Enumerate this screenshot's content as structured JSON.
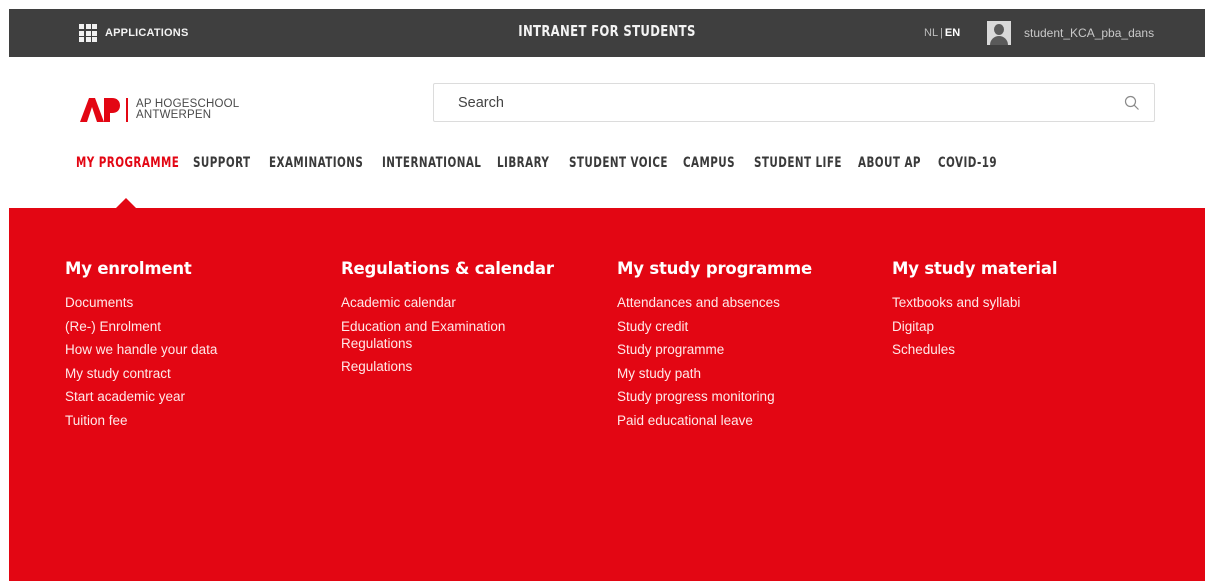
{
  "topbar": {
    "applications_label": "APPLICATIONS",
    "apps_icon": "grid-icon",
    "title": "INTRANET FOR STUDENTS",
    "lang_nl": "NL",
    "lang_sep": "|",
    "lang_en": "EN",
    "avatar_icon": "user-avatar-icon",
    "username": "student_KCA_pba_dans"
  },
  "logo": {
    "mark": "AP",
    "line1": "AP HOGESCHOOL",
    "line2": "ANTWERPEN",
    "brand_color": "#e30613"
  },
  "search": {
    "placeholder": "Search",
    "icon": "search-icon"
  },
  "nav": {
    "items": [
      {
        "label": "MY PROGRAMME",
        "active": true
      },
      {
        "label": "SUPPORT"
      },
      {
        "label": "EXAMINATIONS"
      },
      {
        "label": "INTERNATIONAL"
      },
      {
        "label": "LIBRARY"
      },
      {
        "label": "STUDENT VOICE"
      },
      {
        "label": "CAMPUS"
      },
      {
        "label": "STUDENT LIFE"
      },
      {
        "label": "ABOUT AP"
      },
      {
        "label": "COVID-19"
      }
    ]
  },
  "mega": {
    "columns": [
      {
        "title": "My enrolment",
        "links": [
          "Documents",
          "(Re-) Enrolment",
          "How we handle your data",
          "My study contract",
          "Start academic year",
          "Tuition fee"
        ]
      },
      {
        "title": "Regulations & calendar",
        "links": [
          "Academic calendar",
          "Education and Examination Regulations",
          "Regulations"
        ]
      },
      {
        "title": "My study programme",
        "links": [
          "Attendances and absences",
          "Study credit",
          "Study programme",
          "My study path",
          "Study progress monitoring",
          "Paid educational leave"
        ]
      },
      {
        "title": "My study material",
        "links": [
          "Textbooks and syllabi",
          "Digitap",
          "Schedules"
        ]
      }
    ]
  },
  "colors": {
    "topbar_bg": "#3f3f3f",
    "menu_bg": "#e30613",
    "nav_text": "#3a3a3a",
    "nav_active": "#e30613"
  }
}
